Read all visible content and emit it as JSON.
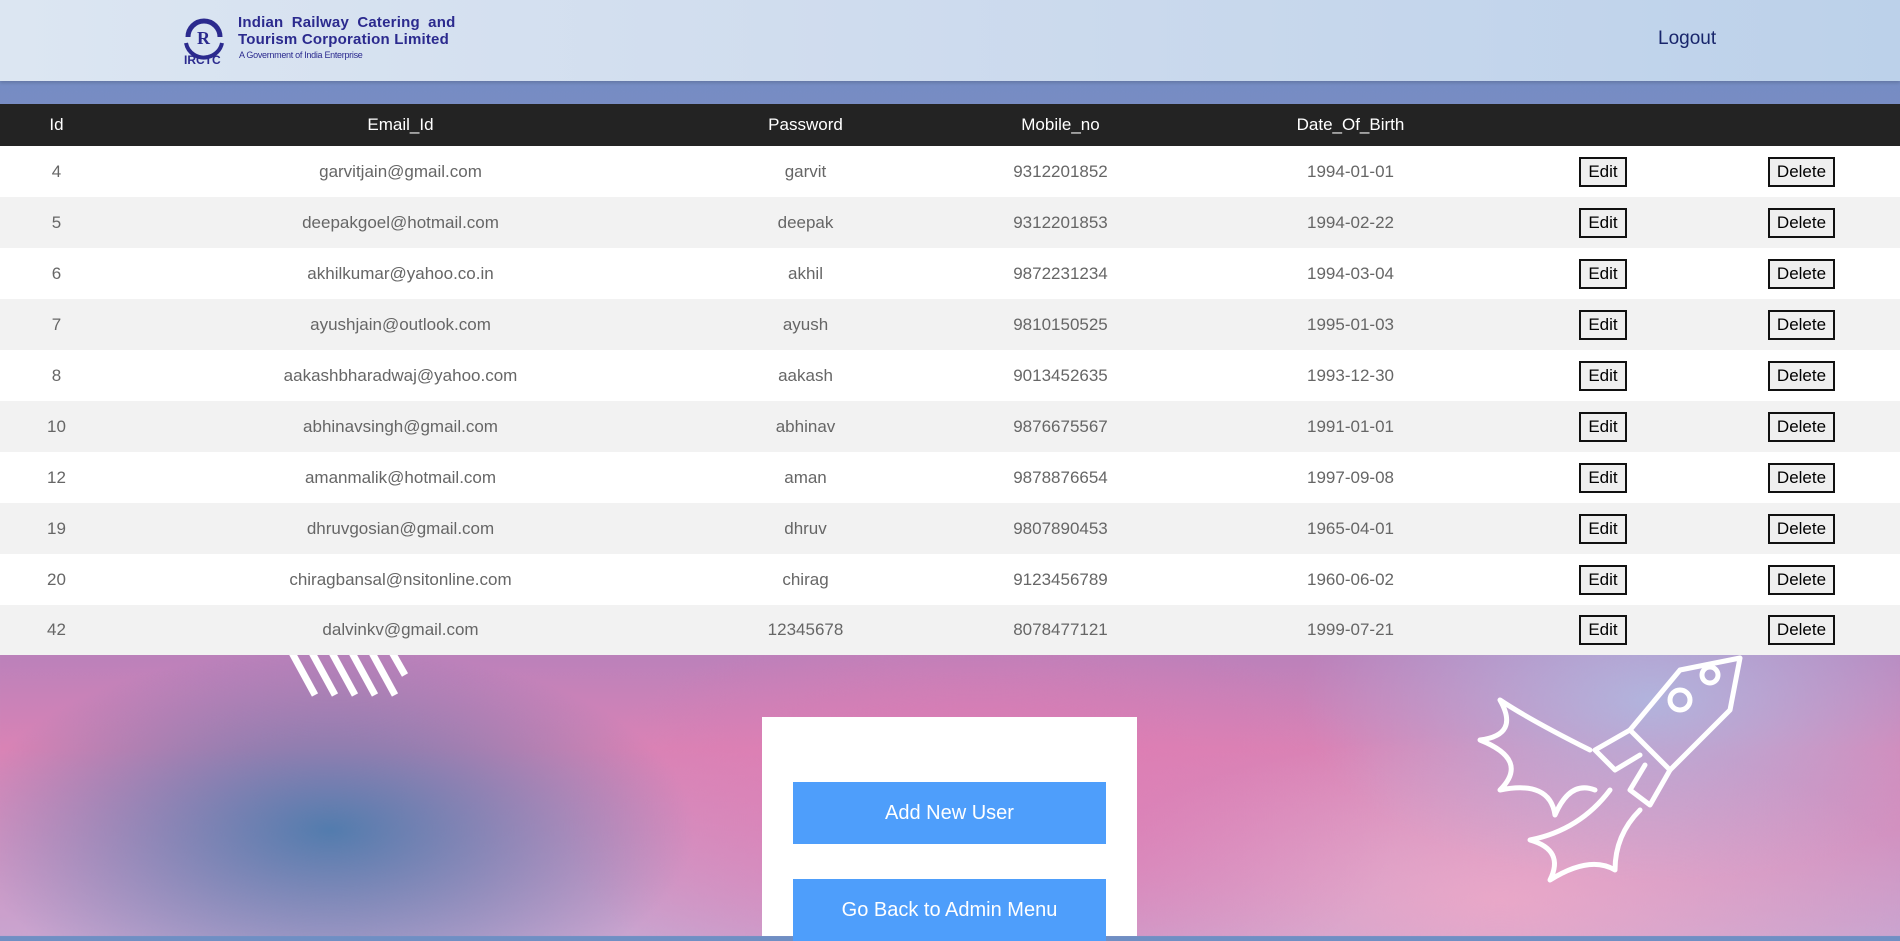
{
  "header": {
    "logo_line1": "Indian Railway Catering and",
    "logo_line2": "Tourism Corporation Limited",
    "logo_line3": "A Government of India Enterprise",
    "logo_abbr": "IRCTC",
    "logout_label": "Logout"
  },
  "table": {
    "columns": [
      "Id",
      "Email_Id",
      "Password",
      "Mobile_no",
      "Date_Of_Birth"
    ],
    "rows": [
      {
        "id": "4",
        "email": "garvitjain@gmail.com",
        "password": "garvit",
        "mobile": "9312201852",
        "dob": "1994-01-01",
        "edit": "Edit",
        "delete": "Delete"
      },
      {
        "id": "5",
        "email": "deepakgoel@hotmail.com",
        "password": "deepak",
        "mobile": "9312201853",
        "dob": "1994-02-22",
        "edit": "Edit",
        "delete": "Delete"
      },
      {
        "id": "6",
        "email": "akhilkumar@yahoo.co.in",
        "password": "akhil",
        "mobile": "9872231234",
        "dob": "1994-03-04",
        "edit": "Edit",
        "delete": "Delete"
      },
      {
        "id": "7",
        "email": "ayushjain@outlook.com",
        "password": "ayush",
        "mobile": "9810150525",
        "dob": "1995-01-03",
        "edit": "Edit",
        "delete": "Delete"
      },
      {
        "id": "8",
        "email": "aakashbharadwaj@yahoo.com",
        "password": "aakash",
        "mobile": "9013452635",
        "dob": "1993-12-30",
        "edit": "Edit",
        "delete": "Delete"
      },
      {
        "id": "10",
        "email": "abhinavsingh@gmail.com",
        "password": "abhinav",
        "mobile": "9876675567",
        "dob": "1991-01-01",
        "edit": "Edit",
        "delete": "Delete"
      },
      {
        "id": "12",
        "email": "amanmalik@hotmail.com",
        "password": "aman",
        "mobile": "9878876654",
        "dob": "1997-09-08",
        "edit": "Edit",
        "delete": "Delete"
      },
      {
        "id": "19",
        "email": "dhruvgosian@gmail.com",
        "password": "dhruv",
        "mobile": "9807890453",
        "dob": "1965-04-01",
        "edit": "Edit",
        "delete": "Delete"
      },
      {
        "id": "20",
        "email": "chiragbansal@nsitonline.com",
        "password": "chirag",
        "mobile": "9123456789",
        "dob": "1960-06-02",
        "edit": "Edit",
        "delete": "Delete"
      },
      {
        "id": "42",
        "email": "dalvinkv@gmail.com",
        "password": "12345678",
        "mobile": "8078477121",
        "dob": "1999-07-21",
        "edit": "Edit",
        "delete": "Delete"
      }
    ]
  },
  "actions": {
    "add_label": "Add New User",
    "back_label": "Go Back to Admin Menu"
  },
  "colors": {
    "table_header_bg": "#232323",
    "action_button_bg": "#4e9efb",
    "logo_text": "#2b2a8e"
  }
}
